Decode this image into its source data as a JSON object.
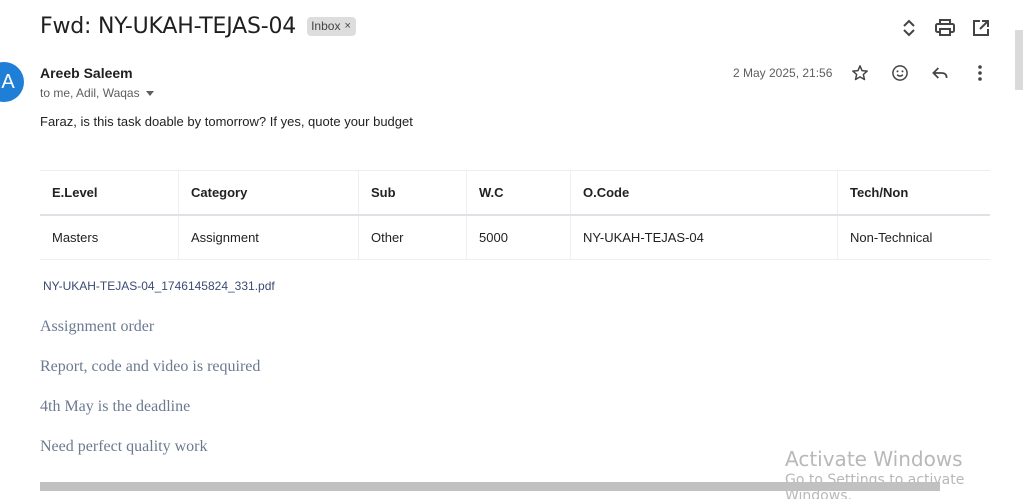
{
  "subject": {
    "title": "Fwd: NY-UKAH-TEJAS-04",
    "label": "Inbox",
    "label_close": "×"
  },
  "header_icons": [
    "expand-collapse-icon",
    "print-icon",
    "open-in-new-window-icon"
  ],
  "message": {
    "avatar_letter": "A",
    "sender": "Areeb Saleem",
    "recipients": "to me, Adil, Waqas",
    "date": "2 May 2025, 21:56",
    "actions": [
      "star-icon",
      "emoji-icon",
      "reply-icon",
      "more-vert-icon"
    ],
    "greeting": "Faraz, is this task doable by tomorrow? If yes, quote your budget"
  },
  "table": {
    "headers": [
      "E.Level",
      "Category",
      "Sub",
      "W.C",
      "O.Code",
      "Tech/Non"
    ],
    "rows": [
      [
        "Masters",
        "Assignment",
        "Other",
        "5000",
        "NY-UKAH-TEJAS-04",
        "Non-Technical"
      ]
    ]
  },
  "attachment": "NY-UKAH-TEJAS-04_1746145824_331.pdf",
  "lines": [
    "Assignment order",
    "Report, code and video is required",
    "4th May is the deadline",
    "Need perfect quality work"
  ],
  "watermark": {
    "title": "Activate Windows",
    "subtitle": "Go to Settings to activate Windows."
  },
  "colors": {
    "avatar": "#1f7fd6",
    "label_chip": "#dddddd",
    "link": "#3c4a73",
    "serif_text": "#6c7a90"
  }
}
